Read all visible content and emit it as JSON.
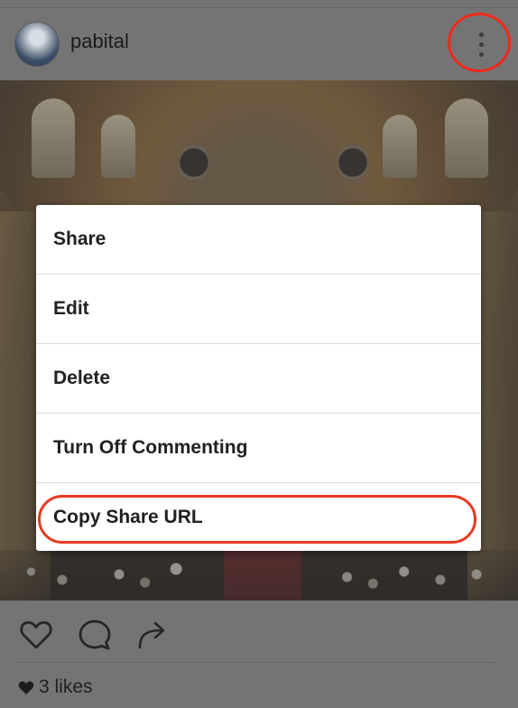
{
  "header": {
    "username": "pabital",
    "more_icon": "vertical-ellipsis-icon"
  },
  "options_menu": {
    "items": [
      {
        "label": "Share"
      },
      {
        "label": "Edit"
      },
      {
        "label": "Delete"
      },
      {
        "label": "Turn Off Commenting"
      },
      {
        "label": "Copy Share URL"
      }
    ],
    "highlight_color": "#e63a24"
  },
  "actions": {
    "like_icon": "heart-outline-icon",
    "comment_icon": "comment-bubble-icon",
    "share_icon": "share-arrow-icon"
  },
  "likes": {
    "text": "3 likes",
    "icon": "heart-filled-icon"
  },
  "colors": {
    "overlay": "#747474",
    "menu_background": "#ffffff",
    "callout_red": "#f2281a"
  }
}
